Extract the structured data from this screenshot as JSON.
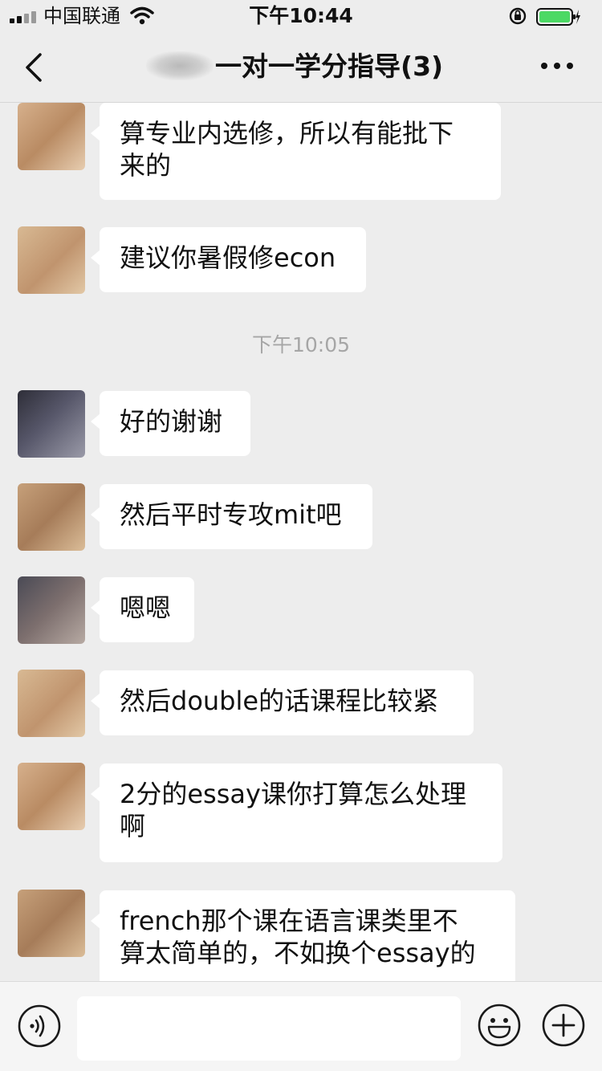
{
  "status_bar": {
    "carrier": "中国联通",
    "time": "下午10:44",
    "signal_icon": "signal-bars-icon",
    "wifi_icon": "wifi-icon",
    "lock_icon": "orientation-lock-icon",
    "battery_icon": "battery-charging-icon",
    "battery_color": "#4cd964"
  },
  "nav": {
    "title": "一对一学分指导(3)",
    "back_icon": "chevron-left-icon",
    "more_icon": "more-dots-icon"
  },
  "messages": [
    {
      "lines": [
        "算专业内选修，所以有能批下",
        "来的"
      ]
    },
    {
      "lines": [
        "建议你暑假修econ"
      ]
    },
    {
      "lines": [
        "好的谢谢"
      ]
    },
    {
      "lines": [
        "然后平时专攻mit吧"
      ]
    },
    {
      "lines": [
        "嗯嗯"
      ]
    },
    {
      "lines": [
        "然后double的话课程比较紧"
      ]
    },
    {
      "lines": [
        "2分的essay课你打算怎么处理",
        "啊"
      ]
    },
    {
      "lines": [
        "french那个课在语言课类里不",
        "算太简单的，不如换个essay的"
      ]
    }
  ],
  "time_divider": "下午10:05",
  "input_bar": {
    "voice_icon": "voice-input-icon",
    "emoji_icon": "emoji-icon",
    "plus_icon": "plus-circle-icon",
    "text_value": ""
  },
  "colors": {
    "background": "#ededed",
    "bubble": "#ffffff",
    "divider_text": "#a6a6a6"
  }
}
